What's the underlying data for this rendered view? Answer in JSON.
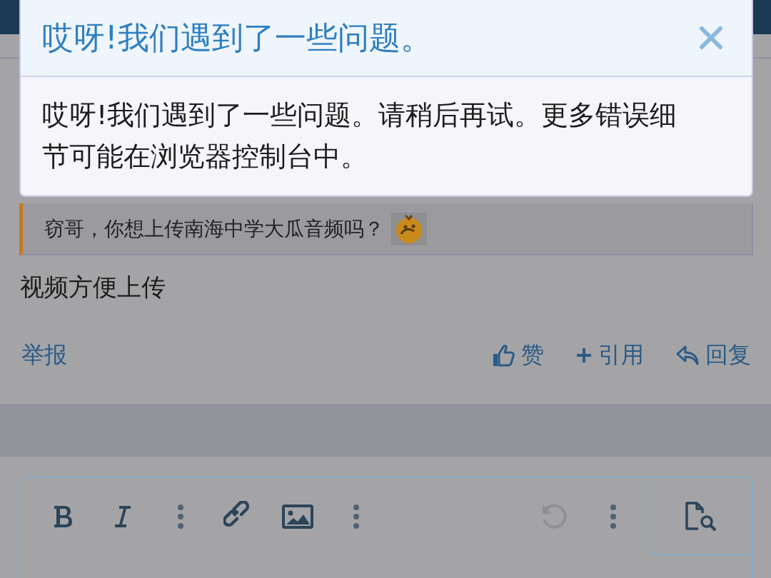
{
  "dialog": {
    "title": "哎呀!我们遇到了一些问题。",
    "message": "哎呀!我们遇到了一些问题。请稍后再试。更多错误细节可能在浏览器控制台中。"
  },
  "quote": {
    "text": "窃哥，你想上传南海中学大瓜音频吗？"
  },
  "post": {
    "text": "视频方便上传",
    "report": "举报",
    "actions": [
      {
        "kind": "like",
        "label": "赞"
      },
      {
        "kind": "quote",
        "label": "引用"
      },
      {
        "kind": "reply",
        "label": "回复"
      }
    ]
  },
  "editor": {
    "toolbar": [
      {
        "kind": "bold",
        "disabled": false
      },
      {
        "kind": "italic",
        "disabled": false
      },
      {
        "kind": "more",
        "disabled": false
      },
      {
        "kind": "link",
        "disabled": false
      },
      {
        "kind": "image",
        "disabled": false
      },
      {
        "kind": "more",
        "disabled": false
      },
      {
        "kind": "undo",
        "disabled": true
      },
      {
        "kind": "more",
        "disabled": false
      }
    ]
  }
}
